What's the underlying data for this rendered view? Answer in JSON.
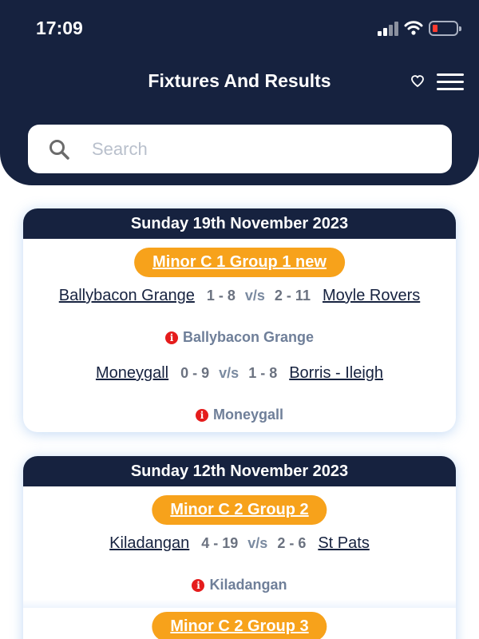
{
  "status_bar": {
    "time": "17:09"
  },
  "header": {
    "title": "Fixtures And Results"
  },
  "search": {
    "placeholder": "Search",
    "value": ""
  },
  "colors": {
    "navy": "#16223f",
    "accent": "#f7a21b",
    "info_red": "#e51c1c"
  },
  "days": [
    {
      "date": "Sunday 19th November 2023",
      "groups": [
        {
          "name": "Minor C 1 Group 1 new",
          "matches": [
            {
              "home": "Ballybacon Grange",
              "home_score": "1 - 8",
              "vs": "v/s",
              "away_score": "2 - 11",
              "away": "Moyle Rovers",
              "note": "Ballybacon Grange"
            },
            {
              "home": "Moneygall",
              "home_score": "0 - 9",
              "vs": "v/s",
              "away_score": "1 - 8",
              "away": "Borris - Ileigh",
              "note": "Moneygall"
            }
          ]
        }
      ]
    },
    {
      "date": "Sunday 12th November 2023",
      "groups": [
        {
          "name": "Minor C 2 Group 2",
          "matches": [
            {
              "home": "Kiladangan",
              "home_score": "4 - 19",
              "vs": "v/s",
              "away_score": "2 - 6",
              "away": "St Pats",
              "note": "Kiladangan"
            }
          ]
        },
        {
          "name": "Minor C 2 Group 3",
          "matches": []
        }
      ]
    }
  ]
}
